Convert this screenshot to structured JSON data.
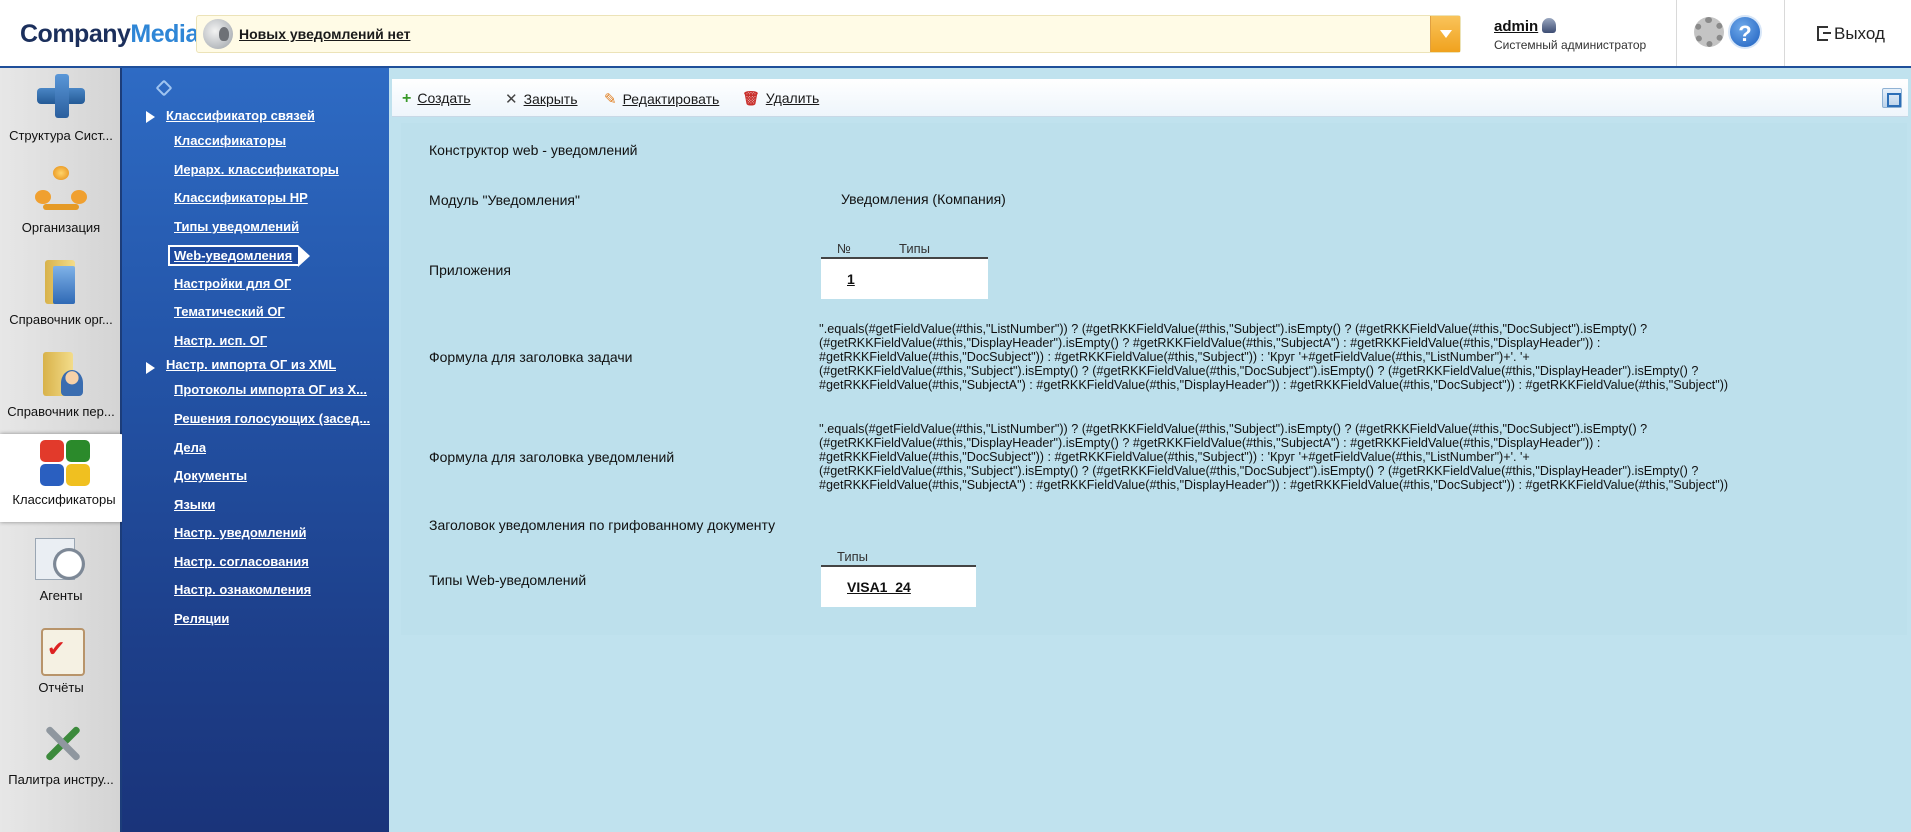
{
  "header": {
    "logo_part1": "Company",
    "logo_part2": "Media",
    "notification_text": "Новых уведомлений нет",
    "user_name": "admin",
    "user_role": "Системный администратор",
    "help_label": "?",
    "logout_label": "Выход"
  },
  "rail": {
    "items": [
      {
        "label": "Структура Сист...",
        "icon": "structure-icon"
      },
      {
        "label": "Организация",
        "icon": "organization-icon"
      },
      {
        "label": "Справочник орг...",
        "icon": "book-icon"
      },
      {
        "label": "Справочник пер...",
        "icon": "personnel-book-icon"
      },
      {
        "label": "Классификаторы",
        "icon": "puzzle-icon"
      },
      {
        "label": "Агенты",
        "icon": "clock-icon"
      },
      {
        "label": "Отчёты",
        "icon": "report-icon"
      },
      {
        "label": "Палитра инстру...",
        "icon": "tools-icon"
      }
    ]
  },
  "nav": {
    "items": [
      {
        "label": "Классификатор связей",
        "type": "group"
      },
      {
        "label": "Классификаторы",
        "type": "sub"
      },
      {
        "label": "Иерарх. классификаторы",
        "type": "sub"
      },
      {
        "label": "Классификаторы НР",
        "type": "sub"
      },
      {
        "label": "Типы уведомлений",
        "type": "sub"
      },
      {
        "label": "Web-уведомления",
        "type": "sub",
        "selected": true
      },
      {
        "label": "Настройки для ОГ",
        "type": "sub"
      },
      {
        "label": "Тематический ОГ",
        "type": "sub"
      },
      {
        "label": "Настр. исп. ОГ",
        "type": "sub"
      },
      {
        "label": "Настр. импорта ОГ из XML",
        "type": "group"
      },
      {
        "label": "Протоколы импорта ОГ из X...",
        "type": "sub"
      },
      {
        "label": "Решения голосующих (засед...",
        "type": "sub"
      },
      {
        "label": "Дела",
        "type": "sub"
      },
      {
        "label": "Документы",
        "type": "sub"
      },
      {
        "label": "Языки",
        "type": "sub"
      },
      {
        "label": "Настр. уведомлений",
        "type": "sub"
      },
      {
        "label": "Настр. согласования",
        "type": "sub"
      },
      {
        "label": "Настр. ознакомления",
        "type": "sub"
      },
      {
        "label": "Реляции",
        "type": "sub"
      }
    ]
  },
  "toolbar": {
    "create": "Создать",
    "close": "Закрыть",
    "edit": "Редактировать",
    "delete": "Удалить"
  },
  "form": {
    "title": "Конструктор web - уведомлений",
    "module_label": "Модуль \"Уведомления\"",
    "module_value": "Уведомления (Компания)",
    "apps_label": "Приложения",
    "apps_col_no": "№",
    "apps_col_types": "Типы",
    "apps_row_value": "1",
    "task_formula_label": "Формула для заголовка задачи",
    "task_formula_lines": [
      "''.equals(#getFieldValue(#this,\"ListNumber\")) ? (#getRKKFieldValue(#this,\"Subject\").isEmpty() ? (#getRKKFieldValue(#this,\"DocSubject\").isEmpty() ?",
      "(#getRKKFieldValue(#this,\"DisplayHeader\").isEmpty() ? #getRKKFieldValue(#this,\"SubjectA\") : #getRKKFieldValue(#this,\"DisplayHeader\")) :",
      "#getRKKFieldValue(#this,\"DocSubject\")) : #getRKKFieldValue(#this,\"Subject\")) : 'Круг '+#getFieldValue(#this,\"ListNumber\")+'. '+",
      "(#getRKKFieldValue(#this,\"Subject\").isEmpty() ? (#getRKKFieldValue(#this,\"DocSubject\").isEmpty() ? (#getRKKFieldValue(#this,\"DisplayHeader\").isEmpty() ?",
      "#getRKKFieldValue(#this,\"SubjectA\") : #getRKKFieldValue(#this,\"DisplayHeader\")) : #getRKKFieldValue(#this,\"DocSubject\")) : #getRKKFieldValue(#this,\"Subject\"))"
    ],
    "notif_formula_label": "Формула для заголовка уведомлений",
    "notif_formula_lines": [
      "''.equals(#getFieldValue(#this,\"ListNumber\")) ? (#getRKKFieldValue(#this,\"Subject\").isEmpty() ? (#getRKKFieldValue(#this,\"DocSubject\").isEmpty() ?",
      "(#getRKKFieldValue(#this,\"DisplayHeader\").isEmpty() ? #getRKKFieldValue(#this,\"SubjectA\") : #getRKKFieldValue(#this,\"DisplayHeader\")) :",
      "#getRKKFieldValue(#this,\"DocSubject\")) : #getRKKFieldValue(#this,\"Subject\")) : 'Круг '+#getFieldValue(#this,\"ListNumber\")+'. '+",
      "(#getRKKFieldValue(#this,\"Subject\").isEmpty() ? (#getRKKFieldValue(#this,\"DocSubject\").isEmpty() ? (#getRKKFieldValue(#this,\"DisplayHeader\").isEmpty() ?",
      "#getRKKFieldValue(#this,\"SubjectA\") : #getRKKFieldValue(#this,\"DisplayHeader\")) : #getRKKFieldValue(#this,\"DocSubject\")) : #getRKKFieldValue(#this,\"Subject\"))"
    ],
    "classified_header_label": "Заголовок уведомления по грифованному документу",
    "web_types_label": "Типы Web-уведомлений",
    "web_types_col": "Типы",
    "web_types_value": "VISA1_24"
  }
}
